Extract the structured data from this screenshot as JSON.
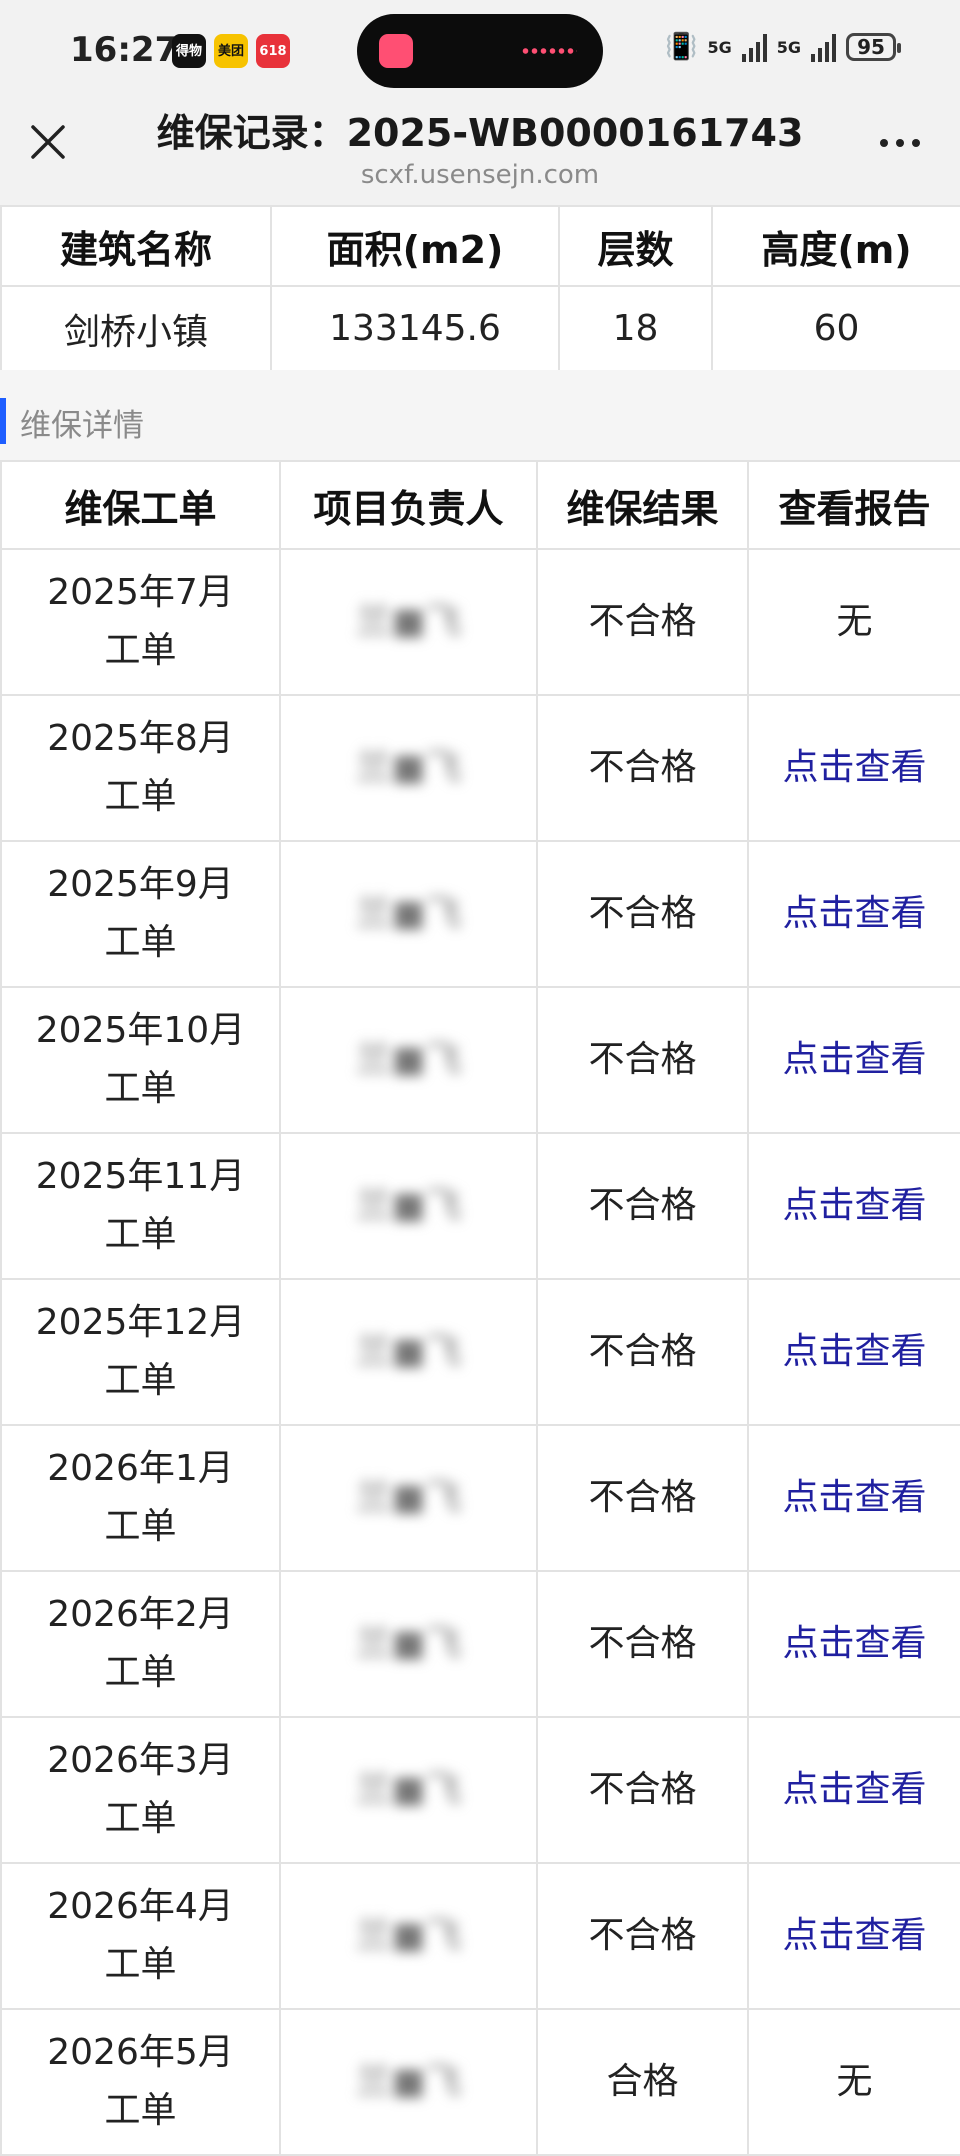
{
  "status_bar": {
    "time": "16:27",
    "apps": [
      {
        "label": "得物",
        "color": "#111111"
      },
      {
        "label": "美团",
        "color": "#f7c300"
      },
      {
        "label": "618",
        "color": "#e8323a"
      }
    ],
    "signal_1": "5G",
    "signal_2": "5G",
    "battery": "95"
  },
  "nav": {
    "title": "维保记录：2025-WB0000161743",
    "domain": "scxf.usensejn.com",
    "close_icon": "close-icon",
    "more_icon": "more-icon"
  },
  "building_table": {
    "headers": [
      "建筑名称",
      "面积(m2)",
      "层数",
      "高度(m)"
    ],
    "row": [
      "剑桥小镇",
      "133145.6",
      "18",
      "60"
    ]
  },
  "section": {
    "title": "维保详情",
    "accent": "#1e5eff"
  },
  "maintenance_table": {
    "headers": [
      "维保工单",
      "项目负责人",
      "维保结果",
      "查看报告"
    ],
    "rows": [
      {
        "order_l1": "2025年7月",
        "order_l2": "工单",
        "owner": "兰■飞",
        "result": "不合格",
        "report": "无"
      },
      {
        "order_l1": "2025年8月",
        "order_l2": "工单",
        "owner": "兰■飞",
        "result": "不合格",
        "report": "点击查看"
      },
      {
        "order_l1": "2025年9月",
        "order_l2": "工单",
        "owner": "兰■飞",
        "result": "不合格",
        "report": "点击查看"
      },
      {
        "order_l1": "2025年10月",
        "order_l2": "工单",
        "owner": "兰■飞",
        "result": "不合格",
        "report": "点击查看"
      },
      {
        "order_l1": "2025年11月",
        "order_l2": "工单",
        "owner": "兰■飞",
        "result": "不合格",
        "report": "点击查看"
      },
      {
        "order_l1": "2025年12月",
        "order_l2": "工单",
        "owner": "兰■飞",
        "result": "不合格",
        "report": "点击查看"
      },
      {
        "order_l1": "2026年1月",
        "order_l2": "工单",
        "owner": "兰■飞",
        "result": "不合格",
        "report": "点击查看"
      },
      {
        "order_l1": "2026年2月",
        "order_l2": "工单",
        "owner": "兰■飞",
        "result": "不合格",
        "report": "点击查看"
      },
      {
        "order_l1": "2026年3月",
        "order_l2": "工单",
        "owner": "兰■飞",
        "result": "不合格",
        "report": "点击查看"
      },
      {
        "order_l1": "2026年4月",
        "order_l2": "工单",
        "owner": "兰■飞",
        "result": "不合格",
        "report": "点击查看"
      },
      {
        "order_l1": "2026年5月",
        "order_l2": "工单",
        "owner": "兰■飞",
        "result": "合格",
        "report": "无"
      }
    ],
    "link_color": "#2020a0"
  }
}
